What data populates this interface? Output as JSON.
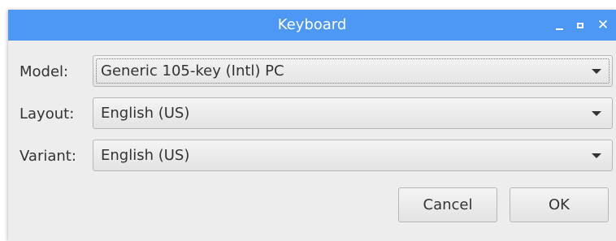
{
  "window": {
    "title": "Keyboard",
    "minimize_glyph": "_",
    "maximize_glyph": "□",
    "close_glyph": "✕"
  },
  "form": {
    "model": {
      "label": "Model:",
      "value": "Generic 105-key (Intl) PC"
    },
    "layout": {
      "label": "Layout:",
      "value": "English (US)"
    },
    "variant": {
      "label": "Variant:",
      "value": "English (US)"
    }
  },
  "buttons": {
    "cancel": "Cancel",
    "ok": "OK"
  },
  "colors": {
    "titlebar": "#4d98f5",
    "window_bg": "#ededed",
    "text": "#333333"
  },
  "icons": {
    "minimize": "minimize-icon",
    "maximize": "maximize-icon",
    "close": "close-icon",
    "dropdown": "chevron-down-icon"
  }
}
